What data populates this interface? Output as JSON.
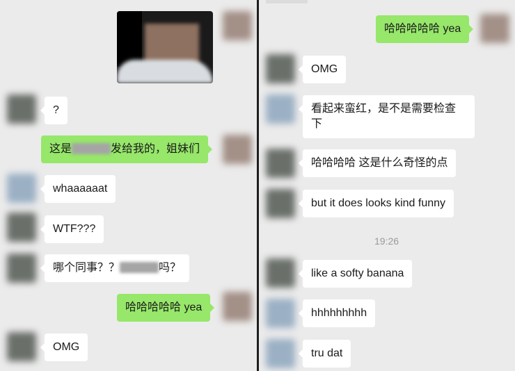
{
  "left": {
    "messages": [
      {
        "text": "?"
      },
      {
        "text_before": "这是",
        "text_after": "发给我的，姐妹们"
      },
      {
        "text": "whaaaaaat"
      },
      {
        "text": "WTF???"
      },
      {
        "text_before": "哪个同事？？",
        "text_after": "吗？"
      },
      {
        "text": "哈哈哈哈哈 yea"
      },
      {
        "text": "OMG"
      }
    ]
  },
  "right": {
    "messages": [
      {
        "text": "哈哈哈哈哈 yea"
      },
      {
        "text": "OMG"
      },
      {
        "text": "看起来蛮红，是不是需要检查下"
      },
      {
        "text": "哈哈哈哈 这是什么奇怪的点"
      },
      {
        "text": "but it does looks kind funny"
      },
      {
        "text": "like a softy banana"
      },
      {
        "text": "hhhhhhhhh"
      },
      {
        "text": "tru dat"
      }
    ],
    "timestamp": "19:26"
  }
}
